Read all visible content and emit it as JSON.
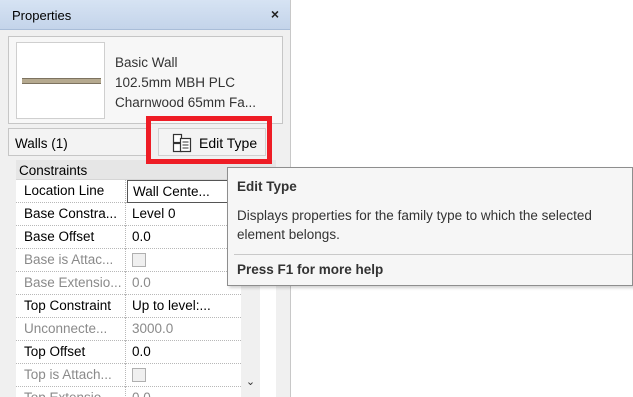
{
  "panel": {
    "title": "Properties",
    "close_glyph": "×"
  },
  "type_selector": {
    "name_lines": [
      "Basic Wall",
      "102.5mm MBH PLC",
      "Charnwood 65mm Fa..."
    ]
  },
  "instance": {
    "label": "Walls (1)",
    "edit_type_label": "Edit Type",
    "edit_type_icon": "edit-type-icon"
  },
  "grid": {
    "group": "Constraints",
    "rows": [
      {
        "name": "Location Line",
        "value": "Wall Cente...",
        "enabled": true
      },
      {
        "name": "Base Constra...",
        "value": "Level 0",
        "enabled": true
      },
      {
        "name": "Base Offset",
        "value": "0.0",
        "enabled": true
      },
      {
        "name": "Base is Attac...",
        "value": "",
        "enabled": false
      },
      {
        "name": "Base Extensio...",
        "value": "0.0",
        "enabled": false
      },
      {
        "name": "Top Constraint",
        "value": "Up to level:...",
        "enabled": true
      },
      {
        "name": "Unconnecte...",
        "value": "3000.0",
        "enabled": false
      },
      {
        "name": "Top Offset",
        "value": "0.0",
        "enabled": true
      },
      {
        "name": "Top is Attach...",
        "value": "",
        "enabled": false
      },
      {
        "name": "Top Extensio...",
        "value": "0.0",
        "enabled": false
      }
    ]
  },
  "tooltip": {
    "title": "Edit Type",
    "body": "Displays properties for the family type to which the selected element belongs.",
    "help": "Press F1 for more help"
  },
  "colors": {
    "highlight": "#ee1c25"
  }
}
